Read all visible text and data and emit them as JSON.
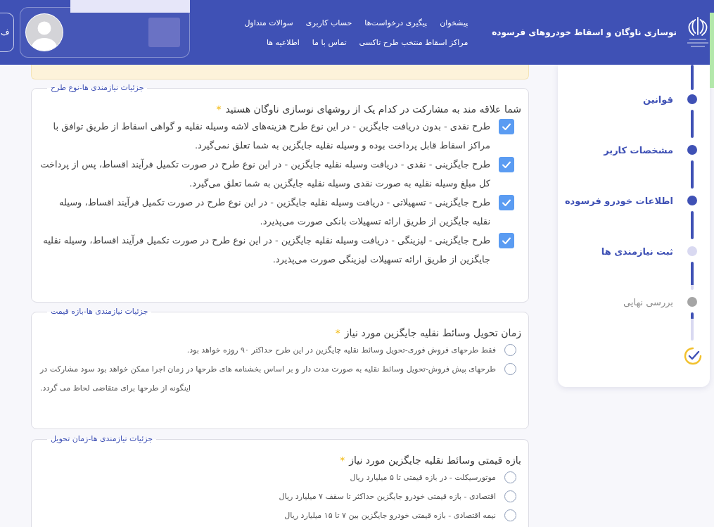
{
  "header": {
    "title": "نوسازی ناوگان و اسقاط خودروهای فرسوده",
    "nav_rows": [
      {
        "links": [
          "پیشخوان",
          "پیگیری درخواست‌ها",
          "حساب کاربری",
          "سوالات متداول"
        ]
      },
      {
        "links": [
          "مراکز اسقاط منتخب طرح تاکسی",
          "تماس با ما",
          "اطلاعیه ها"
        ]
      }
    ],
    "edge_button": "ف"
  },
  "sidebar": {
    "steps": [
      {
        "label": "قوانین",
        "kind": "done"
      },
      {
        "label": "مشخصات کاربر",
        "kind": "done"
      },
      {
        "label": "اطلاعات خودرو فرسوده",
        "kind": "done"
      },
      {
        "label": "ثبت نیازمندی ها",
        "kind": "current"
      },
      {
        "label": "بررسی نهایی",
        "kind": "pending"
      }
    ]
  },
  "sections": [
    {
      "legend": "جزئیات نیازمندی ها-نوع طرح",
      "question": "شما علاقه مند به مشارکت در کدام یک از روشهای نوسازی ناوگان هستید",
      "required_mark": "*",
      "kind": "checkbox",
      "options": [
        {
          "text": "طرح نقدی - بدون دریافت جایگزین - در این نوع طرح هزینه‌های لاشه وسیله نقلیه و گواهی اسقاط از طریق توافق با مراکز اسقاط قابل پرداخت بوده و وسیله نقلیه جایگزین به شما تعلق نمی‌گیرد.",
          "checked": true
        },
        {
          "text": "طرح جایگزینی - نقدی - دریافت وسیله نقلیه جایگزین - در این نوع طرح در صورت تکمیل فرآیند اقساط، پس از پرداخت کل مبلغ وسیله نقلیه به صورت نقدی وسیله نقلیه جایگزین به شما تعلق می‌گیرد.",
          "checked": true
        },
        {
          "text": "طرح جایگزینی - تسهیلاتی - دریافت وسیله نقلیه جایگزین - در این نوع طرح در صورت تکمیل فرآیند اقساط، وسیله نقلیه جایگزین از طریق ارائه تسهیلات بانکی صورت می‌پذیرد.",
          "checked": true
        },
        {
          "text": "طرح جایگزینی - لیزینگی - دریافت وسیله نقلیه جایگزین - در این نوع طرح در صورت تکمیل فرآیند اقساط، وسیله نقلیه جایگزین از طریق ارائه تسهیلات لیزینگی صورت می‌پذیرد.",
          "checked": true
        }
      ]
    },
    {
      "legend": "جزئیات نیازمندی ها-بازه قیمت",
      "question": "زمان تحویل وسائط نقلیه جایگزین مورد نیاز",
      "required_mark": "*",
      "kind": "radio",
      "options": [
        {
          "text": "فقط طرحهای فروش فوری-تحویل وسائط نقلیه چایگزین در این طرح حداکثر ۹۰ روزه خواهد بود.",
          "selected": false
        },
        {
          "text": "طرحهای پیش فروش-تحویل وسائط نقلیه به صورت مدت دار و بر اساس بخشنامه های طرحها در زمان اجرا ممکن خواهد بود سود مشارکت در اینگونه از طرحها برای متقاضی لحاظ می گردد.",
          "selected": false
        }
      ]
    },
    {
      "legend": "جزئیات نیازمندی ها-زمان تحویل",
      "question": "بازه قیمتی وسائط نقلیه جایگزین مورد نیاز",
      "required_mark": "*",
      "kind": "radio",
      "options": [
        {
          "text": "موتورسیکلت - در بازه قیمتی تا ۵ میلیارد ریال",
          "selected": false
        },
        {
          "text": "اقتصادی - بازه قیمتی خودرو جایگزین حداکثر تا سقف ۷ میلیارد ریال",
          "selected": false
        },
        {
          "text": "نیمه اقتصادی - بازه قیمتی خودرو جایگزین بین ۷ تا ۱۵ میلیارد ریال",
          "selected": false
        }
      ]
    }
  ]
}
